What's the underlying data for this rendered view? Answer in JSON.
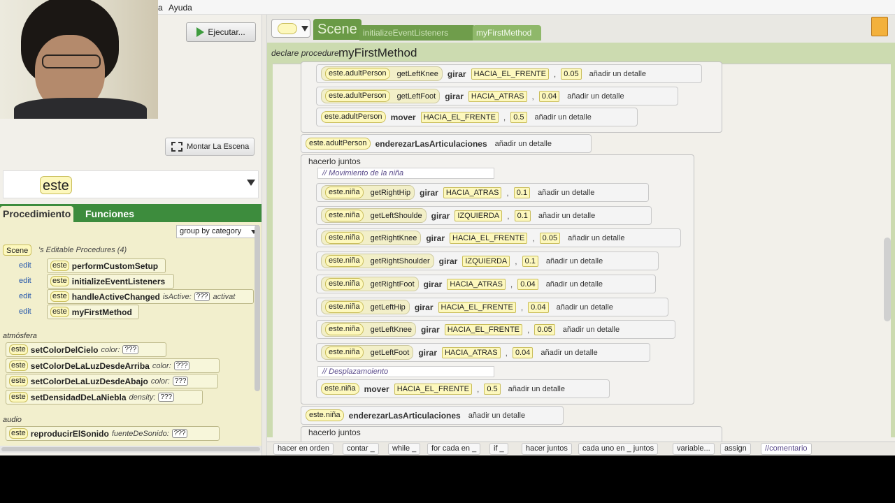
{
  "menu": {
    "items": [
      "a",
      "Ayuda"
    ]
  },
  "run_button": {
    "label": "Ejecutar..."
  },
  "setup_scene_button": {
    "label": "Montar La Escena"
  },
  "object_selector": {
    "value": "este"
  },
  "left_tabs": {
    "procedures": "Procedimiento",
    "functions": "Funciones"
  },
  "group_select": {
    "value": "group by category"
  },
  "editable_procedures": {
    "scene_chip": "Scene",
    "suffix": "'s Editable Procedures (4)",
    "edit_label": "edit",
    "items": [
      {
        "obj": "este",
        "name": "performCustomSetup"
      },
      {
        "obj": "este",
        "name": "initializeEventListeners"
      },
      {
        "obj": "este",
        "name": "handleActiveChanged",
        "param1": "isActive:",
        "value1": "???",
        "param2": "activat"
      },
      {
        "obj": "este",
        "name": "myFirstMethod"
      }
    ]
  },
  "categories": [
    {
      "label": "atmósfera",
      "items": [
        {
          "obj": "este",
          "name": "setColorDelCielo",
          "param": "color:",
          "value": "???"
        },
        {
          "obj": "este",
          "name": "setColorDeLaLuzDesdeArriba",
          "param": "color:",
          "value": "???"
        },
        {
          "obj": "este",
          "name": "setColorDeLaLuzDesdeAbajo",
          "param": "color:",
          "value": "???"
        },
        {
          "obj": "este",
          "name": "setDensidadDeLaNiebla",
          "param": "density:",
          "value": "???"
        }
      ]
    },
    {
      "label": "audio",
      "items": [
        {
          "obj": "este",
          "name": "reproducirElSonido",
          "param": "fuenteDeSonido:",
          "value": "???"
        }
      ]
    }
  ],
  "editor_tabs": {
    "scene": "Scene",
    "tab1": "initializeEventListeners",
    "tab2": "myFirstMethod"
  },
  "procedure": {
    "declare": "declare procedure",
    "name": "myFirstMethod"
  },
  "detail_label": "añadir un detalle",
  "blocks": {
    "adult_top": [
      {
        "obj": "este.adultPerson",
        "getter": "getLeftKnee",
        "verb": "girar",
        "dir": "HACIA_EL_FRENTE",
        "amt": "0.05"
      },
      {
        "obj": "este.adultPerson",
        "getter": "getLeftFoot",
        "verb": "girar",
        "dir": "HACIA_ATRAS",
        "amt": "0.04"
      },
      {
        "obj": "este.adultPerson",
        "verb": "mover",
        "dir": "HACIA_EL_FRENTE",
        "amt": "0.5"
      }
    ],
    "adult_straighten": {
      "obj": "este.adultPerson",
      "verb": "enderezarLasArticulaciones"
    },
    "together_label": "hacerlo juntos",
    "comment1": "// Movimiento de la niña",
    "girl_moves": [
      {
        "obj": "este.niña",
        "getter": "getRightHip",
        "verb": "girar",
        "dir": "HACIA_ATRAS",
        "amt": "0.1"
      },
      {
        "obj": "este.niña",
        "getter": "getLeftShoulde",
        "verb": "girar",
        "dir": "IZQUIERDA",
        "amt": "0.1"
      },
      {
        "obj": "este.niña",
        "getter": "getRightKnee",
        "verb": "girar",
        "dir": "HACIA_EL_FRENTE",
        "amt": "0.05"
      },
      {
        "obj": "este.niña",
        "getter": "getRightShoulder",
        "verb": "girar",
        "dir": "IZQUIERDA",
        "amt": "0.1"
      },
      {
        "obj": "este.niña",
        "getter": "getRightFoot",
        "verb": "girar",
        "dir": "HACIA_ATRAS",
        "amt": "0.04"
      },
      {
        "obj": "este.niña",
        "getter": "getLeftHip",
        "verb": "girar",
        "dir": "HACIA_EL_FRENTE",
        "amt": "0.04"
      },
      {
        "obj": "este.niña",
        "getter": "getLeftKnee",
        "verb": "girar",
        "dir": "HACIA_EL_FRENTE",
        "amt": "0.05"
      },
      {
        "obj": "este.niña",
        "getter": "getLeftFoot",
        "verb": "girar",
        "dir": "HACIA_ATRAS",
        "amt": "0.04"
      }
    ],
    "comment2": "// Desplazamoiento",
    "girl_move": {
      "obj": "este.niña",
      "verb": "mover",
      "dir": "HACIA_EL_FRENTE",
      "amt": "0.5"
    },
    "girl_straighten": {
      "obj": "este.niña",
      "verb": "enderezarLasArticulaciones"
    },
    "together_label2": "hacerlo juntos"
  },
  "toolbar": [
    "hacer en orden",
    "contar _",
    "while _",
    "for cada en _",
    "if _",
    "hacer juntos",
    "cada uno en _ juntos",
    "variable...",
    "assign",
    "//comentario"
  ]
}
